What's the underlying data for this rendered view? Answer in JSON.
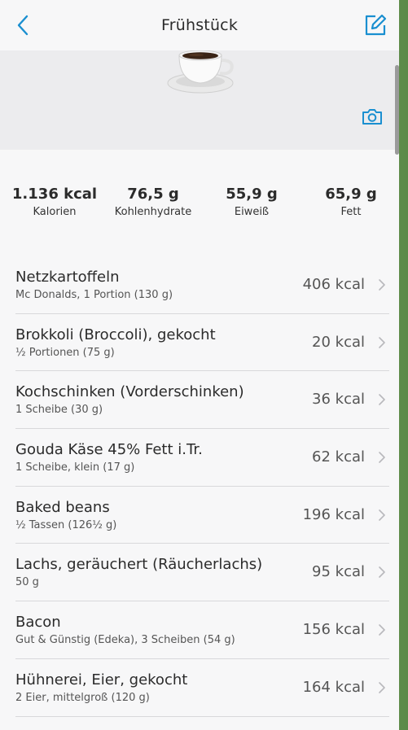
{
  "header": {
    "title": "Frühstück",
    "back_icon": "chevron-left-icon",
    "edit_icon": "edit-icon"
  },
  "hero": {
    "image": "coffee-cup-image",
    "camera_icon": "camera-icon"
  },
  "colors": {
    "accent": "#1a8fd0",
    "text": "#2b2b2b",
    "muted": "#555555"
  },
  "nutrition": [
    {
      "value": "1.136 kcal",
      "label": "Kalorien"
    },
    {
      "value": "76,5 g",
      "label": "Kohlenhydrate"
    },
    {
      "value": "55,9 g",
      "label": "Eiweiß"
    },
    {
      "value": "65,9 g",
      "label": "Fett"
    }
  ],
  "items": [
    {
      "name": "Netzkartoffeln",
      "detail": "Mc Donalds, 1 Portion (130 g)",
      "kcal": "406 kcal"
    },
    {
      "name": "Brokkoli (Broccoli), gekocht",
      "detail": "½ Portionen (75 g)",
      "kcal": "20 kcal"
    },
    {
      "name": "Kochschinken (Vorderschinken)",
      "detail": "1 Scheibe (30 g)",
      "kcal": "36 kcal"
    },
    {
      "name": "Gouda Käse 45% Fett i.Tr.",
      "detail": "1 Scheibe, klein (17 g)",
      "kcal": "62 kcal"
    },
    {
      "name": "Baked beans",
      "detail": "½ Tassen (126½ g)",
      "kcal": "196 kcal"
    },
    {
      "name": "Lachs, geräuchert (Räucherlachs)",
      "detail": "50 g",
      "kcal": "95 kcal"
    },
    {
      "name": "Bacon",
      "detail": "Gut & Günstig (Edeka), 3 Scheiben (54 g)",
      "kcal": "156 kcal"
    },
    {
      "name": "Hühnerei, Eier, gekocht",
      "detail": "2 Eier, mittelgroß (120 g)",
      "kcal": "164 kcal"
    }
  ]
}
